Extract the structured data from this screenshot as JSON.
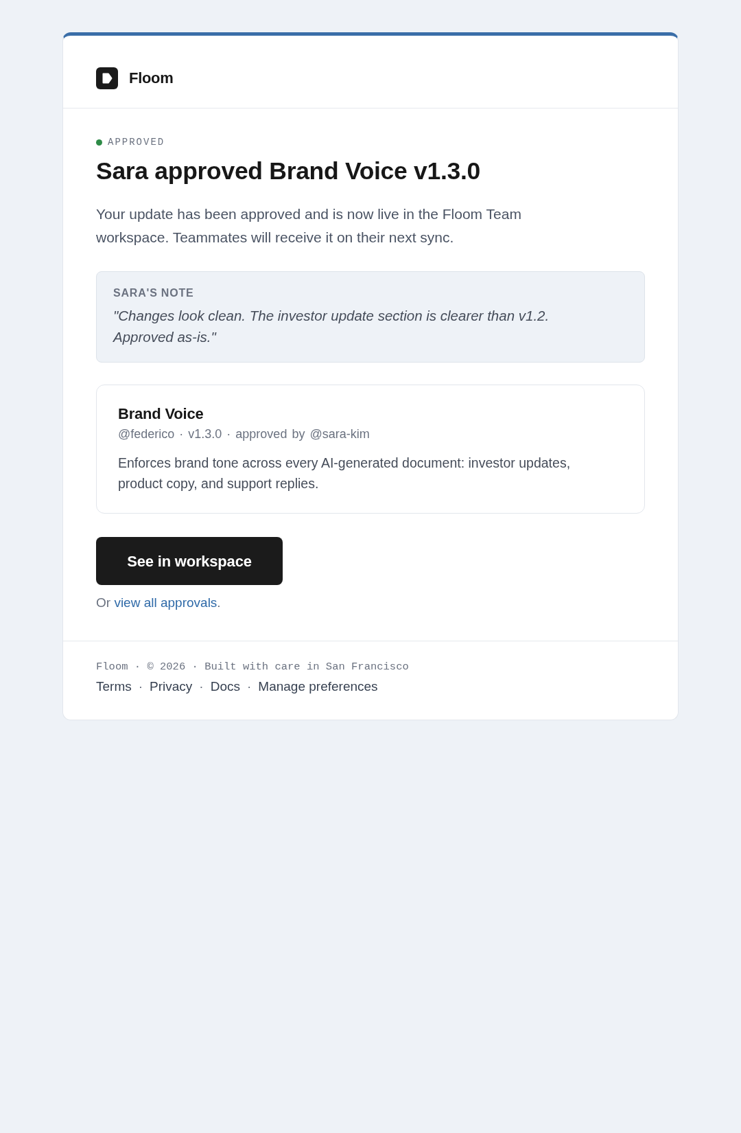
{
  "brand": {
    "name": "Floom"
  },
  "status": {
    "label": "APPROVED",
    "color": "#2e8b47"
  },
  "title": "Sara approved Brand Voice v1.3.0",
  "intro": "Your update has been approved and is now live in the Floom Team workspace. Teammates will receive it on their next sync.",
  "note": {
    "label": "SARA'S NOTE",
    "text": "\"Changes look clean. The investor update section is clearer than v1.2. Approved as-is.\""
  },
  "skill": {
    "name": "Brand Voice",
    "meta": "@federico · v1.3.0 · approved by @sara-kim",
    "description": "Enforces brand tone across every AI-generated document: investor updates, product copy, and support replies."
  },
  "cta": {
    "label": "See in workspace"
  },
  "secondary": {
    "prefix": "Or",
    "link": "view all approvals",
    "suffix": "."
  },
  "footer": {
    "line": "Floom · © 2026 · Built with care in San Francisco",
    "links": [
      {
        "kind": "link",
        "text": "Terms"
      },
      {
        "kind": "separator",
        "text": "·"
      },
      {
        "kind": "link",
        "text": "Privacy"
      },
      {
        "kind": "separator",
        "text": "·"
      },
      {
        "kind": "link",
        "text": "Docs"
      },
      {
        "kind": "separator",
        "text": "·"
      },
      {
        "kind": "link",
        "text": "Manage preferences"
      }
    ]
  }
}
